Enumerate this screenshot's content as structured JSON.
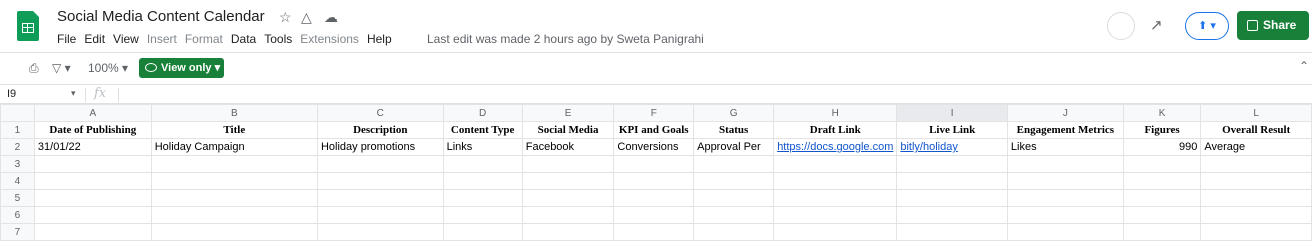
{
  "app": {
    "title": "Social Media Content Calendar",
    "menu": [
      {
        "label": "File",
        "disabled": false
      },
      {
        "label": "Edit",
        "disabled": false
      },
      {
        "label": "View",
        "disabled": false
      },
      {
        "label": "Insert",
        "disabled": true
      },
      {
        "label": "Format",
        "disabled": true
      },
      {
        "label": "Data",
        "disabled": false
      },
      {
        "label": "Tools",
        "disabled": false
      },
      {
        "label": "Extensions",
        "disabled": true
      },
      {
        "label": "Help",
        "disabled": false
      }
    ],
    "last_edit": "Last edit was made 2 hours ago by Sweta Panigrahi",
    "share_label": "Share"
  },
  "toolbar": {
    "zoom": "100%",
    "view_only_label": "View only"
  },
  "formula_bar": {
    "cell_ref": "I9",
    "fx": "fx"
  },
  "sheet": {
    "columns": [
      "A",
      "B",
      "C",
      "D",
      "E",
      "F",
      "G",
      "H",
      "I",
      "J",
      "K",
      "L"
    ],
    "selected_column": "I",
    "rows": [
      {
        "num": "1",
        "cells": [
          "Date of Publishing",
          "Title",
          "Description",
          "Content Type",
          "Social Media",
          "KPI and Goals",
          "Status",
          "Draft Link",
          "Live Link",
          "Engagement Metrics",
          "Figures",
          "Overall Result"
        ]
      },
      {
        "num": "2",
        "cells": [
          "31/01/22",
          "Holiday Campaign",
          "Holiday promotions",
          "Links",
          "Facebook",
          "Conversions",
          "Approval Per",
          "https://docs.google.com",
          "bitly/holiday",
          "Likes",
          "990",
          "Average"
        ]
      },
      {
        "num": "3",
        "cells": [
          "",
          "",
          "",
          "",
          "",
          "",
          "",
          "",
          "",
          "",
          "",
          ""
        ]
      },
      {
        "num": "4",
        "cells": [
          "",
          "",
          "",
          "",
          "",
          "",
          "",
          "",
          "",
          "",
          "",
          ""
        ]
      },
      {
        "num": "5",
        "cells": [
          "",
          "",
          "",
          "",
          "",
          "",
          "",
          "",
          "",
          "",
          "",
          ""
        ]
      },
      {
        "num": "6",
        "cells": [
          "",
          "",
          "",
          "",
          "",
          "",
          "",
          "",
          "",
          "",
          "",
          ""
        ]
      },
      {
        "num": "7",
        "cells": [
          "",
          "",
          "",
          "",
          "",
          "",
          "",
          "",
          "",
          "",
          "",
          ""
        ]
      }
    ]
  },
  "colors": {
    "brand_green": "#188038",
    "sheets_green": "#0f9d58",
    "link_blue": "#1155cc"
  }
}
